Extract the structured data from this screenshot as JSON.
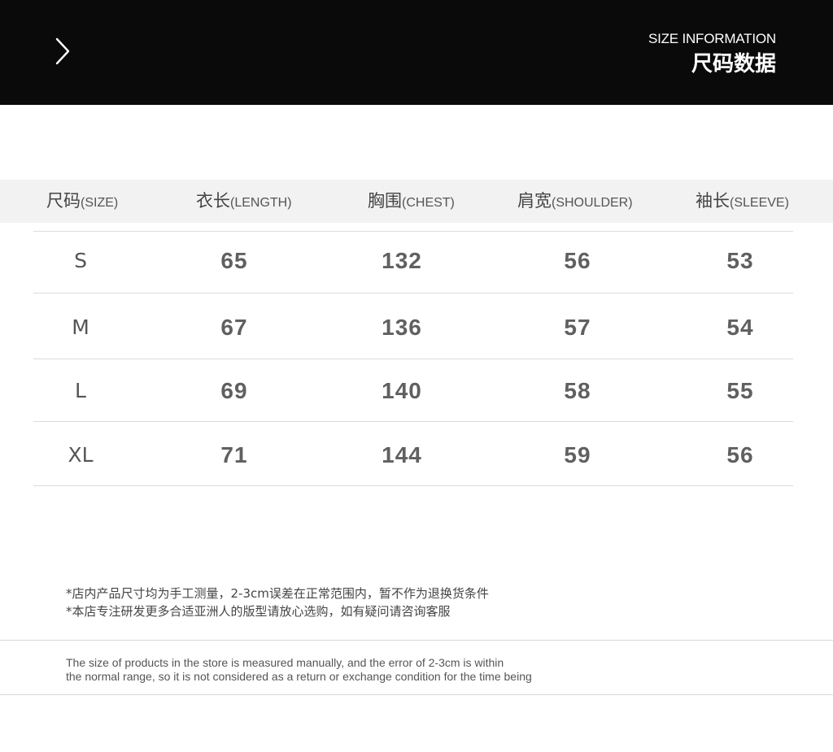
{
  "header": {
    "title_en": "SIZE INFORMATION",
    "title_cn": "尺码数据",
    "icon": "chevron-right-icon"
  },
  "table": {
    "columns": [
      {
        "cn": "尺码",
        "en": "(SIZE)"
      },
      {
        "cn": "衣长",
        "en": "(LENGTH)"
      },
      {
        "cn": "胸围",
        "en": "(CHEST)"
      },
      {
        "cn": "肩宽",
        "en": "(SHOULDER)"
      },
      {
        "cn": "袖长",
        "en": "(SLEEVE)"
      }
    ],
    "rows": [
      [
        "S",
        "65",
        "132",
        "56",
        "53"
      ],
      [
        "M",
        "67",
        "136",
        "57",
        "54"
      ],
      [
        "L",
        "69",
        "140",
        "58",
        "55"
      ],
      [
        "XL",
        "71",
        "144",
        "59",
        "56"
      ]
    ]
  },
  "notes": {
    "cn": [
      "*店内产品尺寸均为手工测量，2-3cm误差在正常范围内，暂不作为退换货条件",
      "*本店专注研发更多合适亚洲人的版型请放心选购，如有疑问请咨询客服"
    ],
    "en": [
      "The size of products in the store is measured manually, and the error of 2-3cm is within",
      "the normal range, so it is not considered as a return or exchange condition for the time being"
    ]
  },
  "colors": {
    "header_bg": "#0a0a0a",
    "table_head_bg": "#f2f2f2",
    "text": "#5a5a5a"
  }
}
